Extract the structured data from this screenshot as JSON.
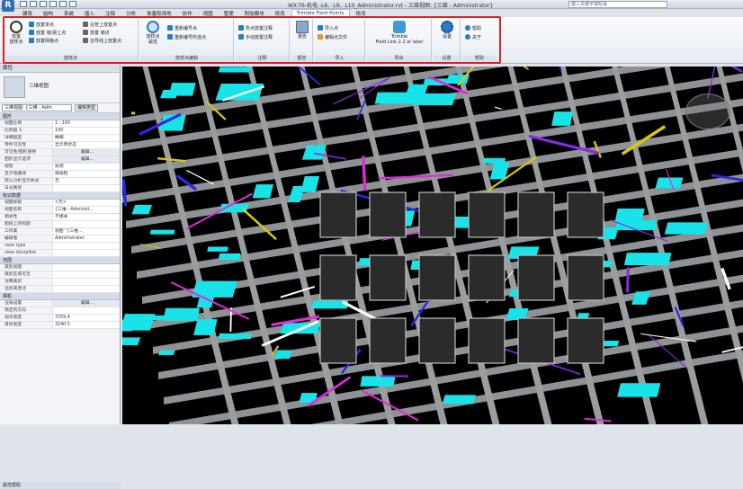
{
  "app": {
    "window_title": "WX-T6-机电 -L6、L9、L10_Administrator.rvt - 三维视图: {三维 - Administrator}",
    "search_placeholder": "键入关键字或短语"
  },
  "tabs": [
    "建筑",
    "结构",
    "系统",
    "插入",
    "注释",
    "分析",
    "体量和场地",
    "协作",
    "视图",
    "管理",
    "附加模块",
    "修改",
    "Trimble Field Points",
    "修改"
  ],
  "active_tab_index": 12,
  "ribbon": {
    "groups": [
      {
        "label": "放样点",
        "big": "放置\n放样点",
        "rows": [
          "放置单点",
          "放置 墙/梁上点",
          "放置网格点",
          "在管上放置点",
          "放置 端点",
          "在导线上放置点"
        ]
      },
      {
        "label": "放样点编辑",
        "big": "放样点\n属性",
        "rows": [
          "重新编号点",
          "重新编号所选点"
        ]
      },
      {
        "label": "注释",
        "rows": [
          "所点放置注释",
          "手动放置注释"
        ]
      },
      {
        "label": "报告",
        "big": "报告"
      },
      {
        "label": "导入",
        "rows": [
          "导入点",
          "编辑点文件"
        ]
      },
      {
        "label": "导出",
        "big": "Trimble\nField Link 2.2 or later"
      },
      {
        "label": "设置",
        "big": "设置"
      },
      {
        "label": "帮助",
        "rows": [
          "帮助",
          "关于"
        ]
      }
    ]
  },
  "properties": {
    "title": "属性",
    "type_name": "三维视图",
    "selector": "三维视图: {三维 - Adm",
    "edit_type": "编辑类型",
    "sections": [
      {
        "name": "图形",
        "rows": [
          [
            "视图比例",
            "1 : 100"
          ],
          [
            "比例值 1:",
            "100"
          ],
          [
            "详细程度",
            "精细"
          ],
          [
            "零件可见性",
            "显示原状态"
          ],
          [
            "可见性/图形替换",
            "编辑..."
          ],
          [
            "图形显示选项",
            "编辑..."
          ],
          [
            "规程",
            "协调"
          ],
          [
            "显示隐藏线",
            "按规程"
          ],
          [
            "默认分析显示样式",
            "无"
          ],
          [
            "日光路径",
            ""
          ]
        ]
      },
      {
        "name": "标识数据",
        "rows": [
          [
            "视图样板",
            "<无>"
          ],
          [
            "视图名称",
            "{三维 - Administ..."
          ],
          [
            "相关性",
            "不相关"
          ],
          [
            "图纸上的标题",
            ""
          ],
          [
            "工作集",
            "视图 \"{三维..."
          ],
          [
            "编辑者",
            "Administrator"
          ],
          [
            "view type",
            ""
          ],
          [
            "view discipline",
            ""
          ]
        ]
      },
      {
        "name": "范围",
        "rows": [
          [
            "裁剪视图",
            ""
          ],
          [
            "裁剪区域可见",
            ""
          ],
          [
            "注释裁剪",
            ""
          ],
          [
            "远剪裁激活",
            ""
          ]
        ]
      },
      {
        "name": "相机",
        "rows": [
          [
            "渲染设置",
            "编辑..."
          ],
          [
            "锁定的方向",
            ""
          ],
          [
            "视点高度",
            "7259.4"
          ],
          [
            "目标高度",
            "3240.5"
          ]
        ]
      }
    ],
    "help": "属性帮助"
  }
}
